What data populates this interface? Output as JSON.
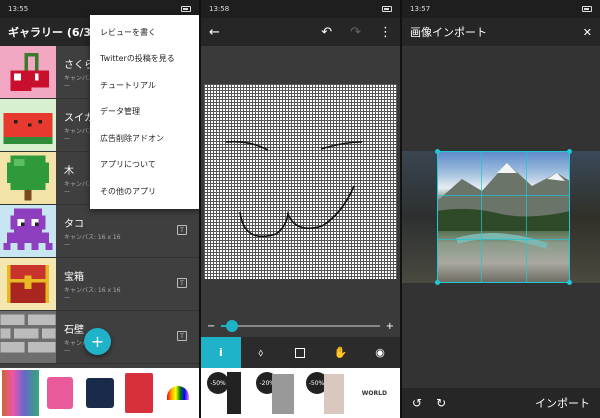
{
  "accent": "#20b2c8",
  "panel1": {
    "status_time": "13:55",
    "title": "ギャラリー (6/30)",
    "menu": [
      "レビューを書く",
      "Twitterの投稿を見る",
      "チュートリアル",
      "データ管理",
      "広告削除アドオン",
      "アプリについて",
      "その他のアプリ"
    ],
    "rows": [
      {
        "title": "さくら",
        "sub": "キャンバス",
        "dash": "—"
      },
      {
        "title": "スイカ",
        "sub": "キャンバス",
        "dash": "—"
      },
      {
        "title": "木",
        "sub": "キャンバス",
        "dash": "—"
      },
      {
        "title": "タコ",
        "sub": "キャンバス: 16 x 16",
        "dash": "—",
        "badge": "T"
      },
      {
        "title": "宝箱",
        "sub": "キャンバス: 16 x 16",
        "dash": "—",
        "badge": "T"
      },
      {
        "title": "石壁",
        "sub": "キャンバス",
        "dash": "—",
        "badge": "T"
      }
    ],
    "fab_label": "+"
  },
  "panel2": {
    "status_time": "13:58",
    "slider_minus": "−",
    "slider_plus": "+",
    "slider_value": 0.07,
    "tools": [
      "pencil-icon",
      "dropper-icon",
      "square-icon",
      "hand-icon",
      "eye-icon"
    ]
  },
  "panel3": {
    "status_time": "13:57",
    "title": "画像インポート",
    "close": "✕",
    "import_label": "インポート"
  },
  "ad": {
    "sale_labels": [
      "-50%",
      "-20%",
      "-50%"
    ],
    "world_text": "WORLD"
  }
}
